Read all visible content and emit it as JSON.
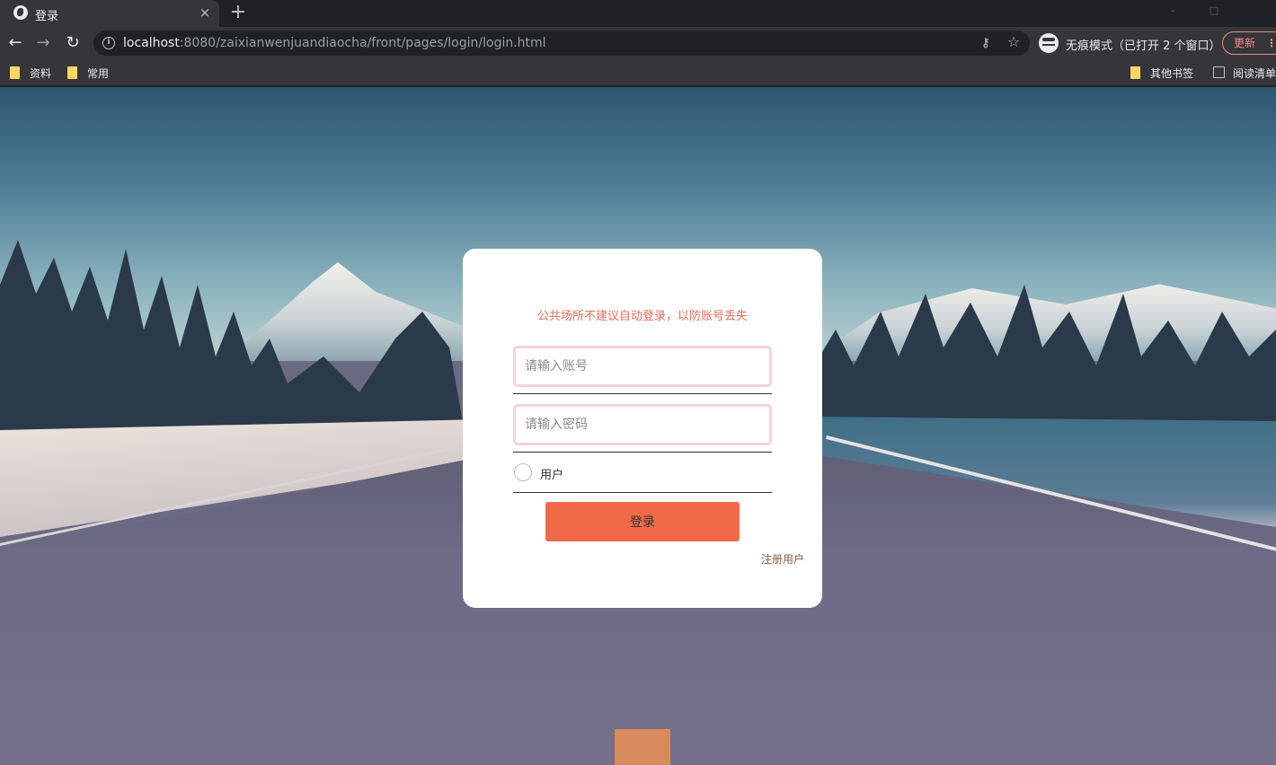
{
  "browser": {
    "tab_title": "登录",
    "tab_close": "×",
    "new_tab": "+",
    "window_buttons": [
      "–",
      "□",
      ""
    ],
    "url_host": "localhost",
    "url_rest": ":8080/zaixianwenjuandiaocha/front/pages/login/login.html",
    "incognito_text": "无痕模式（已打开 2 个窗口）",
    "update_label": "更新",
    "update_menu": "⋮",
    "bookmarks": [
      {
        "label": "资料"
      },
      {
        "label": "常用"
      },
      {
        "label": "其他书签"
      },
      {
        "label": "阅读清单"
      }
    ]
  },
  "login": {
    "notice": "公共场所不建议自动登录，以防账号丢失",
    "account_placeholder": "请输入账号",
    "password_placeholder": "请输入密码",
    "role_option": "用户",
    "submit_label": "登录",
    "register_link": "注册用户"
  },
  "colors": {
    "accent": "#f06a48",
    "notice": "#e66b5a",
    "input_border": "#f6d2d8"
  }
}
